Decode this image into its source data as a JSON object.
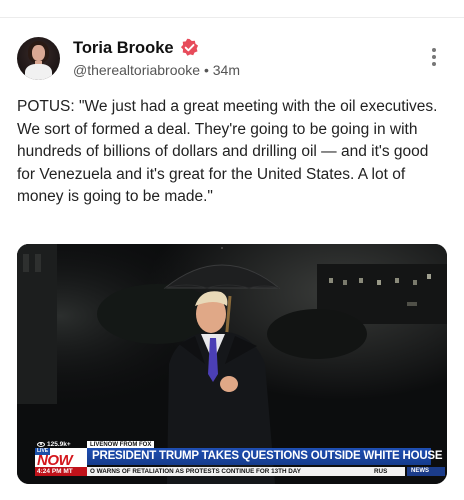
{
  "post": {
    "author_name": "Toria Brooke",
    "handle": "@therealtoriabrooke",
    "separator": "•",
    "time_ago": "34m",
    "text": "POTUS: \"We just had a great meeting with the oil executives. We sort of formed a deal. They're going to be going in with hundreds of billions of dollars and drilling oil — and it's good for Venezuela and it's great for the United States. A lot of money is going to be made.\"",
    "verified_color": "#e74c5b"
  },
  "media": {
    "views": "125.9k+",
    "source": "LIVENOW FROM FOX",
    "live_label": "LIVE",
    "now_label": "NOW",
    "headline": "PRESIDENT TRUMP TAKES QUESTIONS OUTSIDE WHITE HOUSE",
    "time": "4:24 PM MT",
    "ticker": "O WARNS OF RETALIATION AS PROTESTS CONTINUE FOR 13TH DAY",
    "ticker_end": "RUS",
    "news_label": "NEWS"
  },
  "icons": {
    "verified": "verified-badge-icon",
    "more": "vertical-dots-icon",
    "views": "eye-icon"
  }
}
